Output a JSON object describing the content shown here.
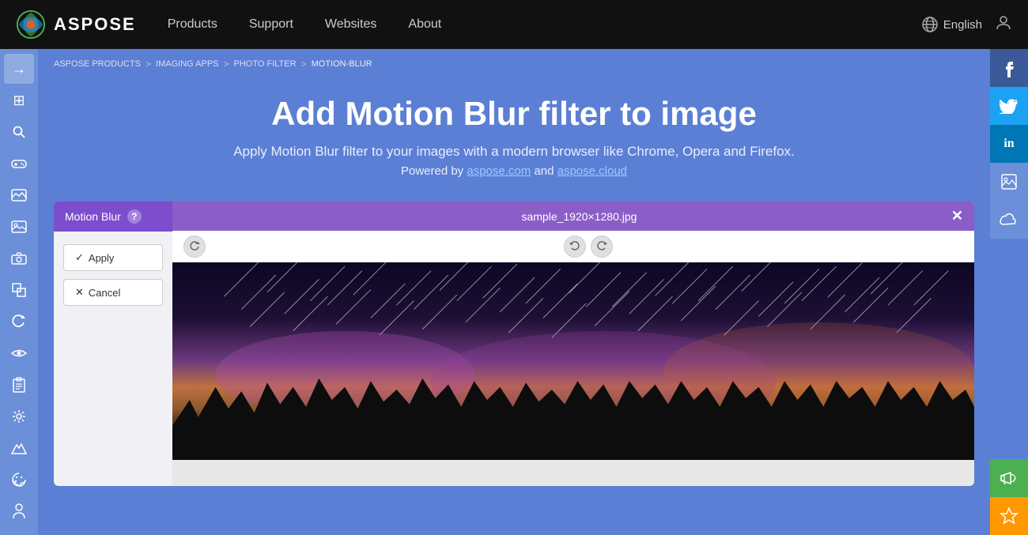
{
  "meta": {
    "title": "Add Motion Blur filter to image"
  },
  "topnav": {
    "logo_text": "ASPOSE",
    "nav_items": [
      {
        "label": "Products",
        "id": "products"
      },
      {
        "label": "Support",
        "id": "support"
      },
      {
        "label": "Websites",
        "id": "websites"
      },
      {
        "label": "About",
        "id": "about"
      }
    ],
    "language": "English",
    "user_icon": "👤"
  },
  "breadcrumb": {
    "items": [
      {
        "label": "ASPOSE PRODUCTS",
        "id": "bc-aspose"
      },
      {
        "label": "IMAGING APPS",
        "id": "bc-imaging"
      },
      {
        "label": "PHOTO FILTER",
        "id": "bc-photo"
      },
      {
        "label": "MOTION-BLUR",
        "id": "bc-motionblur"
      }
    ]
  },
  "hero": {
    "title": "Add Motion Blur filter to image",
    "subtitle": "Apply Motion Blur filter to your images with a modern browser like Chrome, Opera and Firefox.",
    "powered_text": "Powered by aspose.com and aspose.cloud"
  },
  "left_panel": {
    "filter_label": "Motion Blur",
    "help_label": "?",
    "apply_label": "✓ Apply",
    "cancel_label": "✕ Cancel"
  },
  "viewer": {
    "filename": "sample_1920×1280.jpg",
    "close_btn": "✕",
    "undo_icon": "↩",
    "redo_icon": "↪",
    "refresh_icon": "↻"
  },
  "sidebar_icons": [
    {
      "icon": "→",
      "name": "arrow-right"
    },
    {
      "icon": "⊞",
      "name": "grid"
    },
    {
      "icon": "🔍",
      "name": "search"
    },
    {
      "icon": "🎮",
      "name": "gamepad"
    },
    {
      "icon": "🏔",
      "name": "landscape"
    },
    {
      "icon": "🖼",
      "name": "image"
    },
    {
      "icon": "📷",
      "name": "camera"
    },
    {
      "icon": "📐",
      "name": "resize"
    },
    {
      "icon": "🔄",
      "name": "rotate"
    },
    {
      "icon": "👁",
      "name": "eye"
    },
    {
      "icon": "📋",
      "name": "clipboard"
    },
    {
      "icon": "🔧",
      "name": "wrench"
    },
    {
      "icon": "🏔",
      "name": "mountain"
    },
    {
      "icon": "🎨",
      "name": "palette"
    },
    {
      "icon": "👤",
      "name": "person"
    }
  ],
  "social": {
    "facebook": "f",
    "twitter": "t",
    "linkedin": "in",
    "share": "🖼",
    "cloud": "☁",
    "announce": "📢",
    "star": "★"
  },
  "colors": {
    "nav_bg": "#111111",
    "main_bg": "#5b7fd4",
    "sidebar_bg": "#6b8fd8",
    "filter_tab": "#7c4dcc",
    "viewer_header": "#8b5ec7",
    "facebook": "#3b5998",
    "twitter": "#1da1f2",
    "linkedin": "#0077b5",
    "announce": "#4caf50",
    "star": "#ff9800"
  }
}
